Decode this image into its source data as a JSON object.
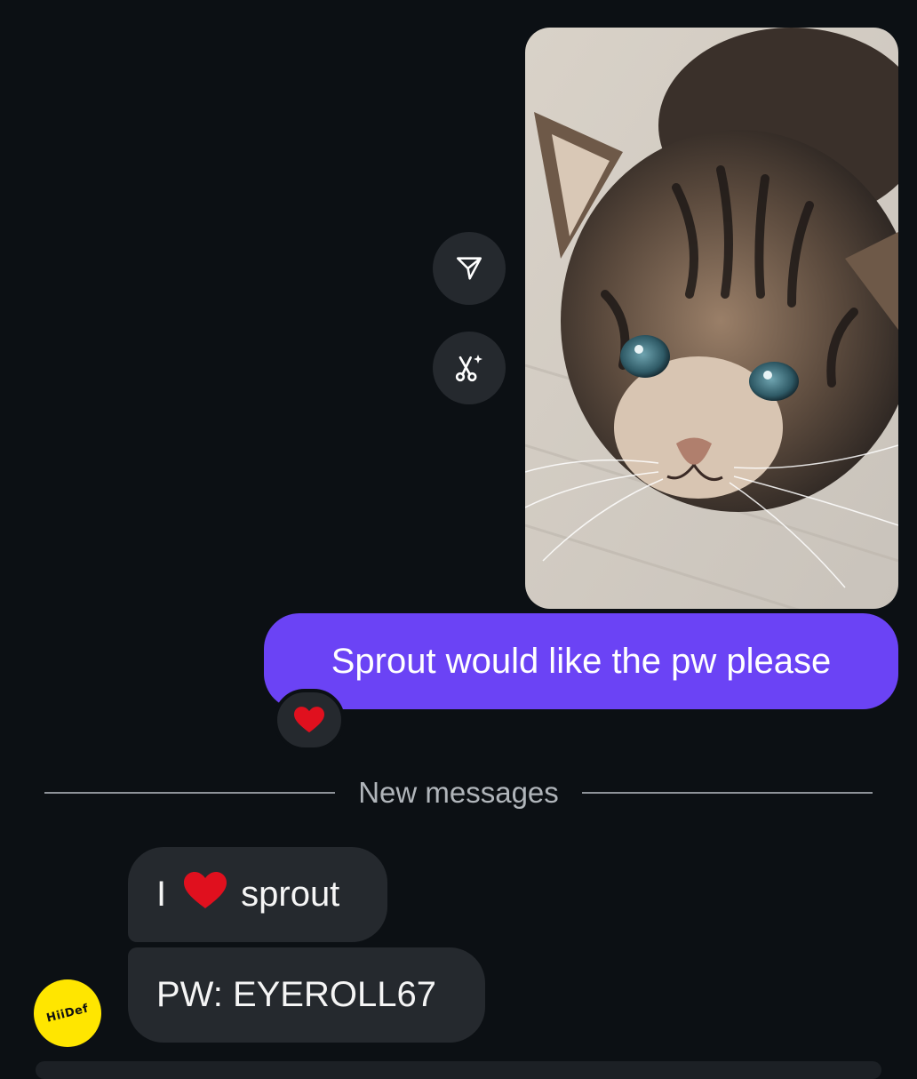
{
  "conversation": {
    "sent_photo": {
      "subject": "tabby kitten photo"
    },
    "photo_actions": [
      {
        "name": "share",
        "icon": "paper-plane-icon"
      },
      {
        "name": "remix",
        "icon": "scissors-sparkle-icon"
      }
    ],
    "sent_message": {
      "text": "Sprout would like the pw please",
      "reaction": "❤️"
    },
    "divider": {
      "label": "New messages"
    },
    "received_messages": [
      {
        "prefix": "I",
        "emoji": "❤️",
        "suffix": "sprout"
      },
      {
        "text": "PW: EYEROLL67"
      }
    ],
    "sender_avatar": {
      "label": "HiiDef"
    }
  },
  "colors": {
    "background": "#0c1014",
    "sent_bubble": "#6b43f5",
    "received_bubble": "#25292e",
    "avatar_bg": "#ffe600",
    "heart": "#e0101e"
  }
}
